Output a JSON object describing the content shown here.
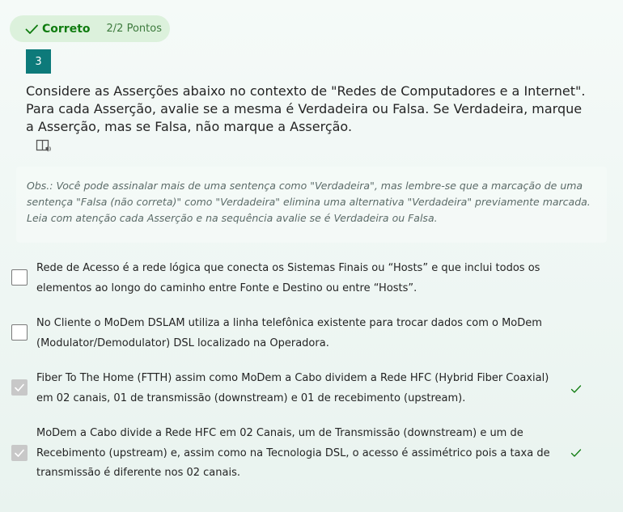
{
  "status": {
    "label": "Correto",
    "points": "2/2 Pontos",
    "icon": "checkmark-icon",
    "color": "#107c10"
  },
  "question": {
    "number": "3",
    "text": "Considere as Asserções abaixo no contexto de \"Redes de Computadores e a Internet\". Para cada Asserção, avalie se a mesma é Verdadeira ou Falsa. Se Verdadeira, marque a Asserção, mas se Falsa, não marque a Asserção.",
    "reader_icon": "immersive-reader-icon",
    "obs": "Obs.: Você pode assinalar mais de uma sentença como \"Verdadeira\", mas lembre-se que a marcação de uma sentença \"Falsa (não correta)\" como \"Verdadeira\" elimina uma alternativa \"Verdadeira\" previamente marcada. Leia com atenção cada Asserção e na sequência avalie se é Verdadeira ou Falsa."
  },
  "options": [
    {
      "text": "Rede de Acesso é a rede lógica que conecta os Sistemas Finais ou “Hosts” e que inclui todos os elementos ao longo do caminho entre Fonte e Destino ou entre “Hosts”.",
      "checked": false,
      "correct": false
    },
    {
      "text": "No Cliente o MoDem DSLAM utiliza a linha telefônica existente para trocar dados com o MoDem (Modulator/Demodulator) DSL localizado na Operadora.",
      "checked": false,
      "correct": false
    },
    {
      "text": "Fiber To The Home (FTTH) assim como MoDem a Cabo dividem a Rede HFC (Hybrid Fiber Coaxial) em 02 canais, 01 de transmissão (downstream) e 01 de recebimento (upstream).",
      "checked": true,
      "correct": true
    },
    {
      "text": "MoDem a Cabo divide a Rede HFC em 02 Canais, um de Transmissão (downstream) e um de Recebimento (upstream) e, assim como na Tecnologia DSL, o acesso é assimétrico pois a taxa de transmissão é diferente nos 02 canais.",
      "checked": true,
      "correct": true
    }
  ]
}
